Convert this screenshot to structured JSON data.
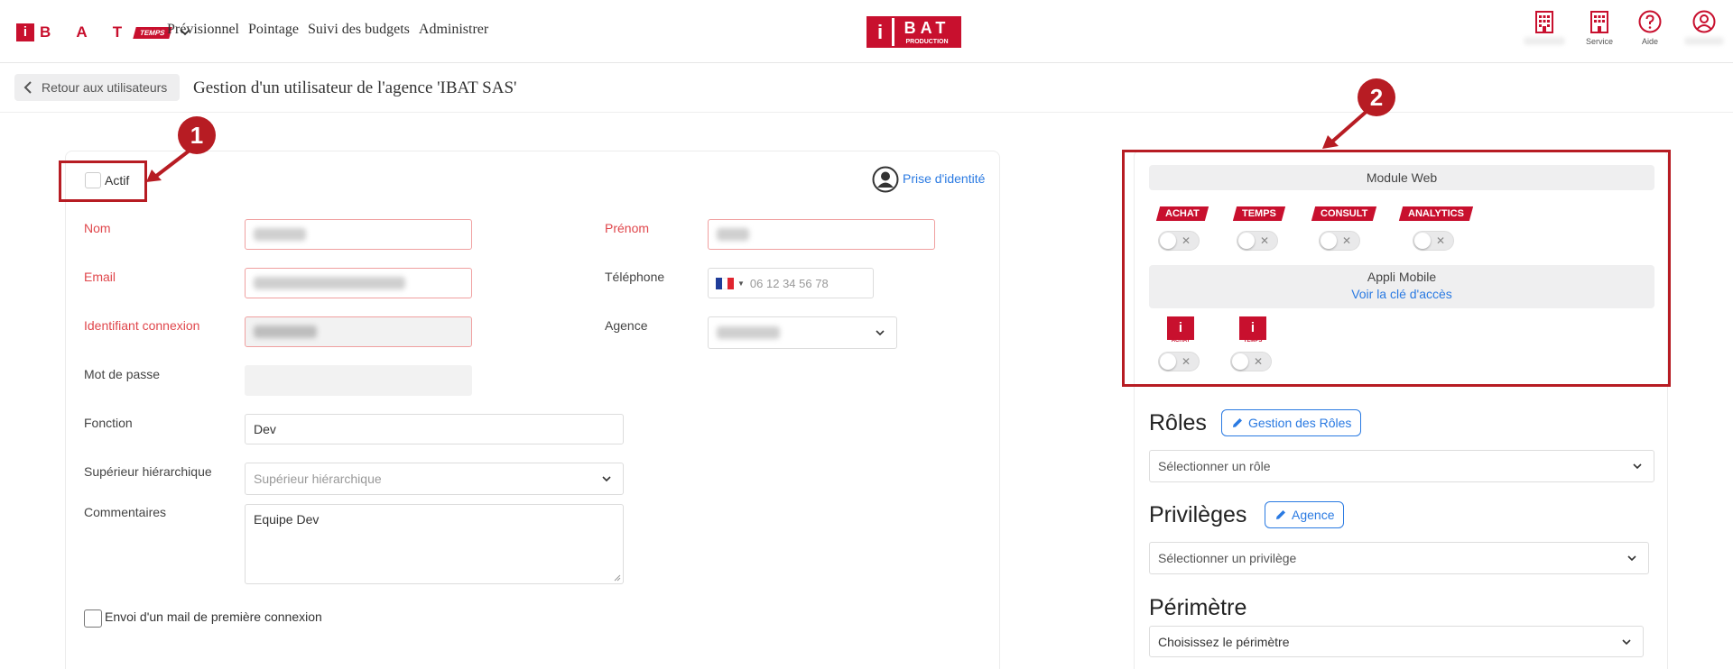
{
  "topbar": {
    "brand_letters": "B A T",
    "brand_tag": "TEMPS",
    "nav": [
      "Prévisionnel",
      "Pointage",
      "Suivi des budgets",
      "Administrer"
    ],
    "center_logo_letters": "BAT",
    "center_logo_sub": "PRODUCTION",
    "icons": [
      {
        "name": "building-icon",
        "label": ""
      },
      {
        "name": "service-icon",
        "label": "Service"
      },
      {
        "name": "help-icon",
        "label": "Aide"
      },
      {
        "name": "user-icon",
        "label": ""
      }
    ]
  },
  "subheader": {
    "back_label": "Retour aux utilisateurs",
    "title": "Gestion d'un utilisateur de l'agence 'IBAT SAS'"
  },
  "form": {
    "actif_label": "Actif",
    "impersonate_label": "Prise d'identité",
    "nom_label": "Nom",
    "prenom_label": "Prénom",
    "email_label": "Email",
    "telephone_label": "Téléphone",
    "telephone_placeholder": "06 12 34 56 78",
    "identifiant_label": "Identifiant connexion",
    "agence_label": "Agence",
    "motdepasse_label": "Mot de passe",
    "fonction_label": "Fonction",
    "fonction_value": "Dev",
    "superieur_label": "Supérieur hiérarchique",
    "superieur_placeholder": "Supérieur hiérarchique",
    "commentaires_label": "Commentaires",
    "commentaires_value": "Equipe Dev",
    "mail_checkbox_label": "Envoi d'un mail de première connexion"
  },
  "annotations": {
    "badge1": "1",
    "badge2": "2",
    "color": "#b71c23"
  },
  "modules": {
    "web_title": "Module Web",
    "web_modules": [
      {
        "label": "ACHAT",
        "enabled": false
      },
      {
        "label": "TEMPS",
        "enabled": false
      },
      {
        "label": "CONSULT",
        "enabled": false
      },
      {
        "label": "ANALYTICS",
        "enabled": false
      }
    ],
    "mobile_title": "Appli Mobile",
    "mobile_link": "Voir la clé d'accès",
    "mobile_apps": [
      {
        "icon": "i",
        "caption": "ACHAT",
        "enabled": false
      },
      {
        "icon": "i",
        "caption": "TEMPS",
        "enabled": false
      }
    ],
    "toggle_off_glyph": "✕"
  },
  "roles": {
    "title": "Rôles",
    "button": "Gestion des Rôles",
    "select_placeholder": "Sélectionner un rôle"
  },
  "privileges": {
    "title": "Privilèges",
    "button": "Agence",
    "select_placeholder": "Sélectionner un privilège"
  },
  "perimetre": {
    "title": "Périmètre",
    "select_placeholder": "Choisissez le périmètre"
  },
  "colors": {
    "brand": "#c8102e",
    "link": "#2a7ae2",
    "required": "#e0474c"
  }
}
